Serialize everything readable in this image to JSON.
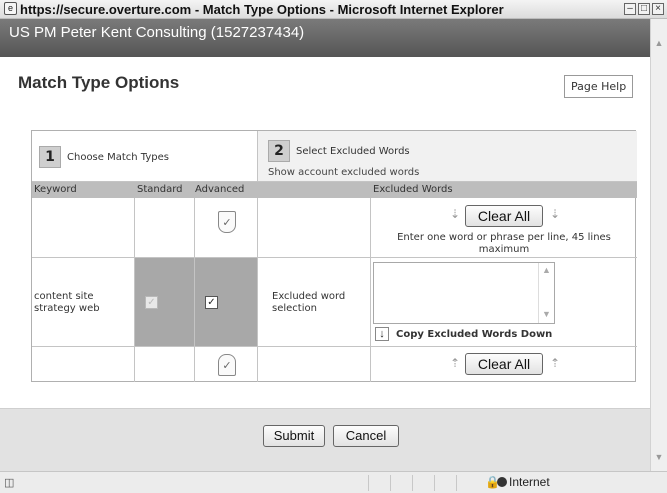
{
  "window": {
    "title": "https://secure.overture.com - Match Type Options - Microsoft Internet Explorer"
  },
  "account": {
    "label": "US PM Peter Kent Consulting (1527237434)"
  },
  "page": {
    "title": "Match Type Options",
    "help_label": "Page Help"
  },
  "step1": {
    "number": "1",
    "label": "Choose Match Types"
  },
  "step2": {
    "number": "2",
    "label": "Select Excluded Words",
    "sub": "Show account excluded words"
  },
  "columns": {
    "keyword": "Keyword",
    "standard": "Standard",
    "advanced": "Advanced",
    "excluded": "Excluded Words"
  },
  "top_row": {
    "clear_all": "Clear All",
    "hint": "Enter one word or phrase per line, 45 lines maximum"
  },
  "keyword_row": {
    "keyword": "content site strategy web",
    "standard_checked": true,
    "standard_disabled": true,
    "advanced_checked": true,
    "excluded_label": "Excluded word selection",
    "excluded_value": "",
    "copy_label": "Copy Excluded Words Down"
  },
  "bottom_row": {
    "clear_all": "Clear All"
  },
  "actions": {
    "submit": "Submit",
    "cancel": "Cancel"
  },
  "status": {
    "zone": "Internet"
  },
  "colors": {
    "account_bar": "#555555",
    "header_row": "#bdbdbd",
    "standard_column": "#a8a8a8"
  }
}
